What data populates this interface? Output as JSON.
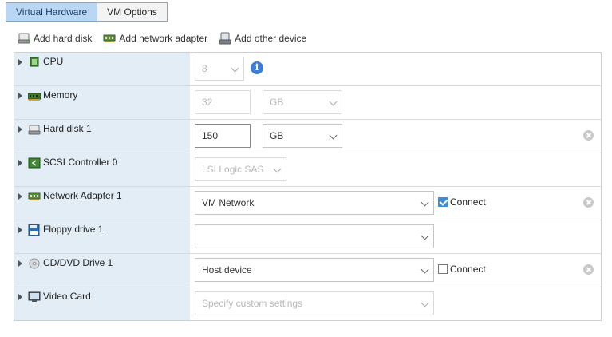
{
  "tabs": [
    {
      "label": "Virtual Hardware",
      "active": true
    },
    {
      "label": "VM Options",
      "active": false
    }
  ],
  "toolbar": {
    "add_hard_disk": "Add hard disk",
    "add_network_adapter": "Add network adapter",
    "add_other_device": "Add other device"
  },
  "devices": {
    "cpu": {
      "label": "CPU",
      "value": "8"
    },
    "memory": {
      "label": "Memory",
      "value": "32",
      "unit": "GB"
    },
    "hard_disk": {
      "label": "Hard disk 1",
      "value": "150",
      "unit": "GB"
    },
    "scsi": {
      "label": "SCSI Controller 0",
      "value": "LSI Logic SAS"
    },
    "network": {
      "label": "Network Adapter 1",
      "value": "VM Network",
      "connect_label": "Connect",
      "connected": true
    },
    "floppy": {
      "label": "Floppy drive 1",
      "value": ""
    },
    "cdrom": {
      "label": "CD/DVD Drive 1",
      "value": "Host device",
      "connect_label": "Connect",
      "connected": false
    },
    "video": {
      "label": "Video Card",
      "value": "Specify custom settings"
    }
  },
  "colors": {
    "accent": "#3b8fd9",
    "tab_active": "#b9d7f4",
    "row_label_bg": "#e2edf5"
  }
}
